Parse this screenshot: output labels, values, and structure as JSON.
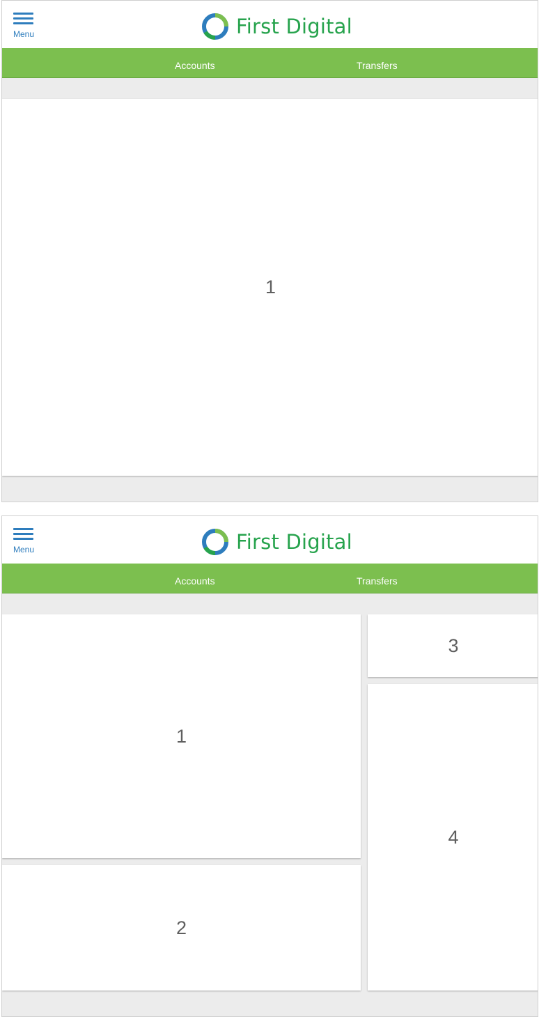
{
  "screens": [
    {
      "menu_label": "Menu",
      "brand": "First Digital",
      "nav": {
        "accounts": "Accounts",
        "transfers": "Transfers"
      },
      "tiles": [
        "1"
      ]
    },
    {
      "menu_label": "Menu",
      "brand": "First Digital",
      "nav": {
        "accounts": "Accounts",
        "transfers": "Transfers"
      },
      "tiles": [
        "1",
        "2",
        "3",
        "4"
      ]
    }
  ],
  "colors": {
    "brand_blue": "#2e7dbd",
    "brand_green": "#27a34d",
    "nav_green": "#7cbf4f",
    "background_gray": "#ececec"
  },
  "icons": {
    "menu": "hamburger-icon",
    "logo": "ring-logo-icon"
  }
}
